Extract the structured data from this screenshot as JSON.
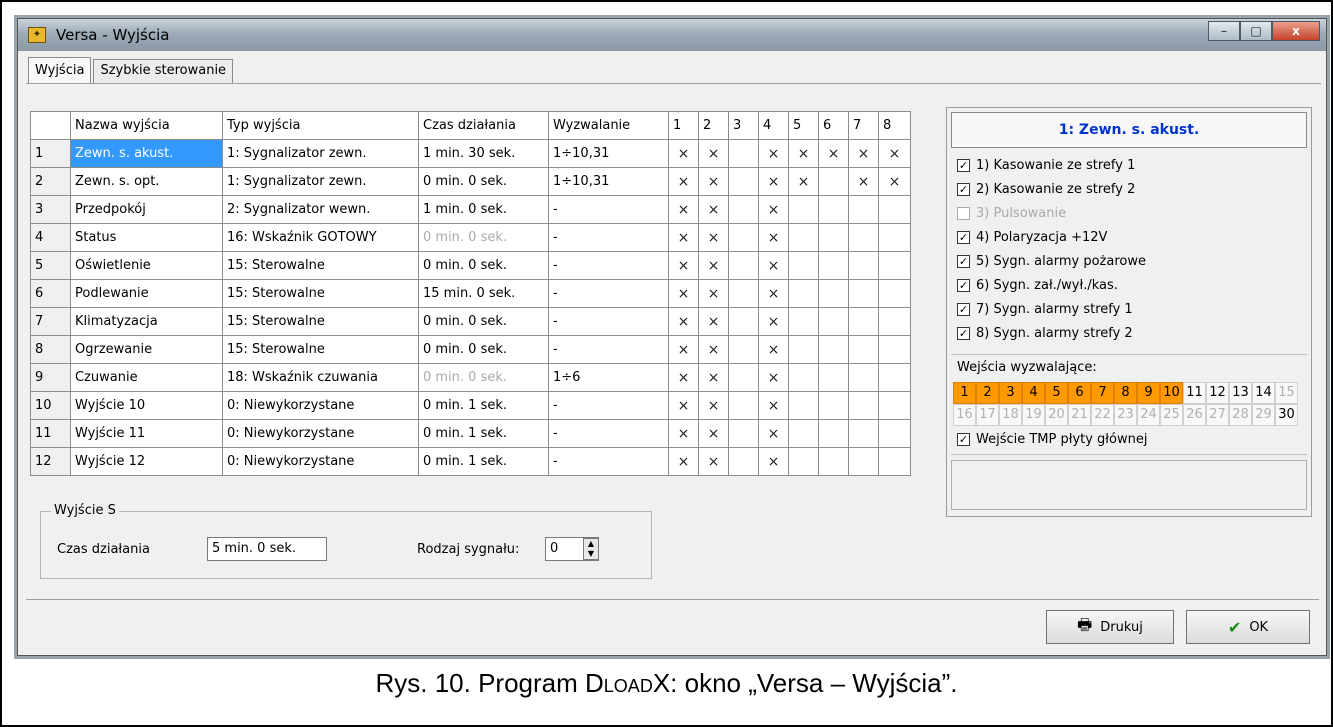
{
  "window": {
    "title": "Versa - Wyjścia",
    "minimize": "–",
    "maximize": "□",
    "close": "x"
  },
  "tabs": [
    "Wyjścia",
    "Szybkie sterowanie"
  ],
  "table": {
    "headers": [
      "",
      "Nazwa wyjścia",
      "Typ wyjścia",
      "Czas działania",
      "Wyzwalanie",
      "1",
      "2",
      "3",
      "4",
      "5",
      "6",
      "7",
      "8"
    ],
    "rows": [
      {
        "no": "1",
        "name": "Zewn. s. akust.",
        "type": "1: Sygnalizator zewn.",
        "time": "1 min. 30 sek.",
        "trigger": "1÷10,31",
        "marks": [
          "×",
          "×",
          "",
          "×",
          "×",
          "×",
          "×",
          "×"
        ]
      },
      {
        "no": "2",
        "name": "Zewn. s. opt.",
        "type": "1: Sygnalizator zewn.",
        "time": "0 min. 0 sek.",
        "trigger": "1÷10,31",
        "marks": [
          "×",
          "×",
          "",
          "×",
          "×",
          "",
          "×",
          "×"
        ]
      },
      {
        "no": "3",
        "name": "Przedpokój",
        "type": "2: Sygnalizator wewn.",
        "time": "1 min. 0 sek.",
        "trigger": "-",
        "marks": [
          "×",
          "×",
          "",
          "×",
          "",
          "",
          "",
          ""
        ]
      },
      {
        "no": "4",
        "name": "Status",
        "type": "16: Wskaźnik GOTOWY",
        "time": "0 min. 0 sek.",
        "trigger": "-",
        "marks": [
          "×",
          "×",
          "",
          "×",
          "",
          "",
          "",
          ""
        ]
      },
      {
        "no": "5",
        "name": "Oświetlenie",
        "type": "15: Sterowalne",
        "time": "0 min. 0 sek.",
        "trigger": "-",
        "marks": [
          "×",
          "×",
          "",
          "×",
          "",
          "",
          "",
          ""
        ]
      },
      {
        "no": "6",
        "name": "Podlewanie",
        "type": "15: Sterowalne",
        "time": "15 min. 0 sek.",
        "trigger": "-",
        "marks": [
          "×",
          "×",
          "",
          "×",
          "",
          "",
          "",
          ""
        ]
      },
      {
        "no": "7",
        "name": "Klimatyzacja",
        "type": "15: Sterowalne",
        "time": "0 min. 0 sek.",
        "trigger": "-",
        "marks": [
          "×",
          "×",
          "",
          "×",
          "",
          "",
          "",
          ""
        ]
      },
      {
        "no": "8",
        "name": "Ogrzewanie",
        "type": "15: Sterowalne",
        "time": "0 min. 0 sek.",
        "trigger": "-",
        "marks": [
          "×",
          "×",
          "",
          "×",
          "",
          "",
          "",
          ""
        ]
      },
      {
        "no": "9",
        "name": "Czuwanie",
        "type": "18: Wskaźnik czuwania",
        "time": "0 min. 0 sek.",
        "trigger": "1÷6",
        "marks": [
          "×",
          "×",
          "",
          "×",
          "",
          "",
          "",
          ""
        ]
      },
      {
        "no": "10",
        "name": "Wyjście 10",
        "type": "0: Niewykorzystane",
        "time": "0 min. 1 sek.",
        "trigger": "-",
        "marks": [
          "×",
          "×",
          "",
          "×",
          "",
          "",
          "",
          ""
        ]
      },
      {
        "no": "11",
        "name": "Wyjście 11",
        "type": "0: Niewykorzystane",
        "time": "0 min. 1 sek.",
        "trigger": "-",
        "marks": [
          "×",
          "×",
          "",
          "×",
          "",
          "",
          "",
          ""
        ]
      },
      {
        "no": "12",
        "name": "Wyjście 12",
        "type": "0: Niewykorzystane",
        "time": "0 min. 1 sek.",
        "trigger": "-",
        "marks": [
          "×",
          "×",
          "",
          "×",
          "",
          "",
          "",
          ""
        ]
      }
    ]
  },
  "output_s": {
    "legend": "Wyjście S",
    "time_label": "Czas działania",
    "time_value": "5 min. 0 sek.",
    "signal_label": "Rodzaj sygnału:",
    "signal_value": "0"
  },
  "details": {
    "header": "1: Zewn. s. akust.",
    "options": [
      {
        "label": "1) Kasowanie ze strefy 1",
        "checked": true,
        "enabled": true
      },
      {
        "label": "2) Kasowanie ze strefy 2",
        "checked": true,
        "enabled": true
      },
      {
        "label": "3) Pulsowanie",
        "checked": false,
        "enabled": false
      },
      {
        "label": "4) Polaryzacja +12V",
        "checked": true,
        "enabled": true
      },
      {
        "label": "5) Sygn. alarmy pożarowe",
        "checked": true,
        "enabled": true
      },
      {
        "label": "6) Sygn. zał./wył./kas.",
        "checked": true,
        "enabled": true
      },
      {
        "label": "7) Sygn. alarmy strefy 1",
        "checked": true,
        "enabled": true
      },
      {
        "label": "8) Sygn. alarmy strefy 2",
        "checked": true,
        "enabled": true
      }
    ],
    "inputs_label": "Wejścia wyzwalające:",
    "inputs": [
      {
        "n": "1",
        "state": "on"
      },
      {
        "n": "2",
        "state": "on"
      },
      {
        "n": "3",
        "state": "on"
      },
      {
        "n": "4",
        "state": "on"
      },
      {
        "n": "5",
        "state": "on"
      },
      {
        "n": "6",
        "state": "on"
      },
      {
        "n": "7",
        "state": "on"
      },
      {
        "n": "8",
        "state": "on"
      },
      {
        "n": "9",
        "state": "on"
      },
      {
        "n": "10",
        "state": "on"
      },
      {
        "n": "11",
        "state": "dark"
      },
      {
        "n": "12",
        "state": "dark"
      },
      {
        "n": "13",
        "state": "dark"
      },
      {
        "n": "14",
        "state": "dark"
      },
      {
        "n": "15",
        "state": "off"
      },
      {
        "n": "16",
        "state": "off"
      },
      {
        "n": "17",
        "state": "off"
      },
      {
        "n": "18",
        "state": "off"
      },
      {
        "n": "19",
        "state": "off"
      },
      {
        "n": "20",
        "state": "off"
      },
      {
        "n": "21",
        "state": "off"
      },
      {
        "n": "22",
        "state": "off"
      },
      {
        "n": "23",
        "state": "off"
      },
      {
        "n": "24",
        "state": "off"
      },
      {
        "n": "25",
        "state": "off"
      },
      {
        "n": "26",
        "state": "off"
      },
      {
        "n": "27",
        "state": "off"
      },
      {
        "n": "28",
        "state": "off"
      },
      {
        "n": "29",
        "state": "off"
      },
      {
        "n": "30",
        "state": "dark"
      }
    ],
    "tmp_label": "Wejście TMP płyty głównej",
    "tmp_checked": true
  },
  "buttons": {
    "print": "Drukuj",
    "ok": "OK"
  },
  "caption": {
    "prefix": "Rys. 10. Program ",
    "program_d": "D",
    "program_load": "load",
    "program_x": "X",
    "suffix": ": okno „Versa – Wyjścia”."
  }
}
